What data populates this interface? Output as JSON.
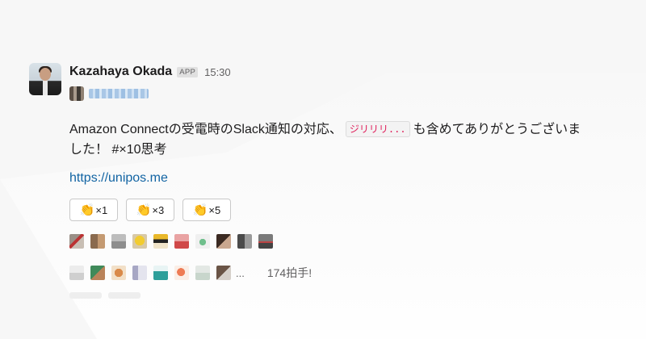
{
  "message": {
    "username": "Kazahaya Okada",
    "app_badge": "APP",
    "timestamp": "15:30",
    "text_before": "Amazon Connectの受電時のSlack通知の対応、",
    "code_chip": "ジリリリ...",
    "text_after": "も含めてありがとうございま",
    "text_line2": "した！ #×10思考",
    "link": "https://unipos.me"
  },
  "reactions": [
    {
      "emoji": "👏",
      "count": "×1"
    },
    {
      "emoji": "👏",
      "count": "×3"
    },
    {
      "emoji": "👏",
      "count": "×5"
    }
  ],
  "clapper_count_text": "174拍手!",
  "more_indicator": "...",
  "colors": {
    "link": "#1264a3",
    "code_chip_text": "#e01e5a",
    "secondary_text": "#616061"
  }
}
